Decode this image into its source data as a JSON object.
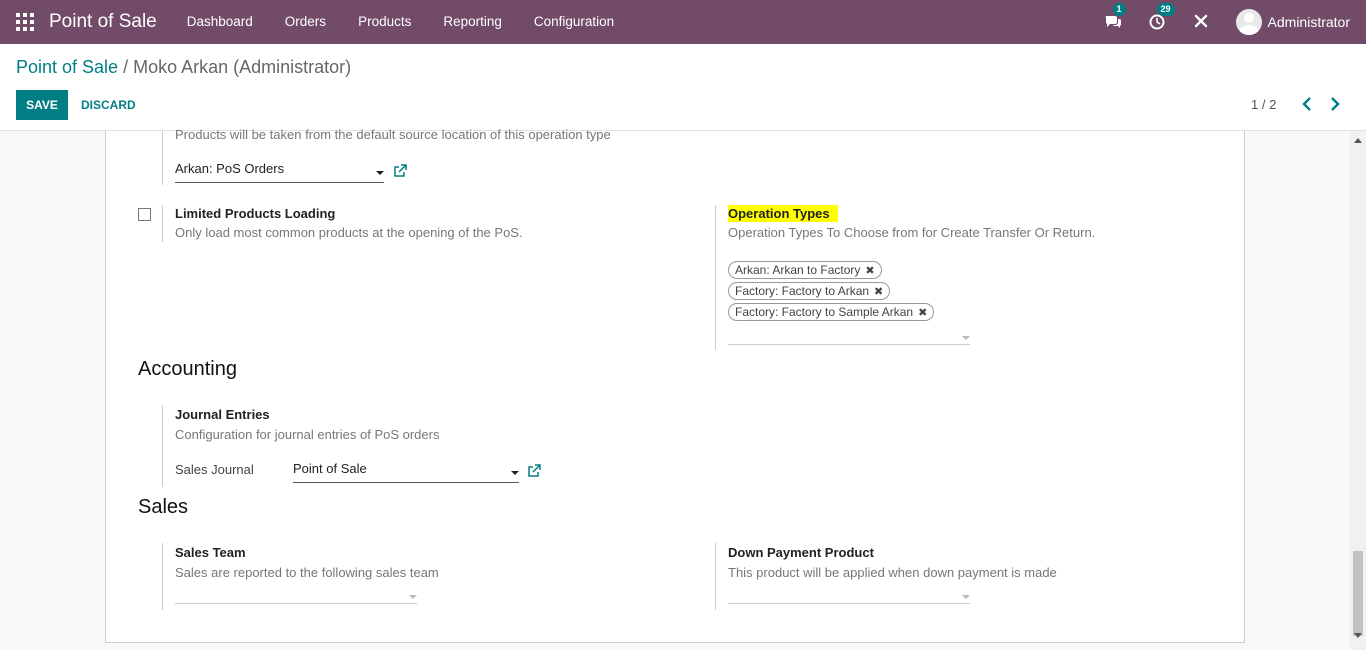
{
  "navbar": {
    "brand": "Point of Sale",
    "menu": [
      "Dashboard",
      "Orders",
      "Products",
      "Reporting",
      "Configuration"
    ],
    "messages_count": "1",
    "activities_count": "29",
    "user_name": "Administrator",
    "accent_color": "#714b67"
  },
  "breadcrumb": {
    "parent": "Point of Sale",
    "separator": "/",
    "current": "Moko Arkan (Administrator)"
  },
  "buttons": {
    "save": "SAVE",
    "discard": "DISCARD"
  },
  "pager": {
    "text": "1 / 2"
  },
  "form": {
    "top_desc": "Products will be taken from the default source location of this operation type",
    "top_select": "Arkan: PoS Orders",
    "limited_loading": {
      "label": "Limited Products Loading",
      "desc": "Only load most common products at the opening of the PoS.",
      "checked": false
    },
    "operation_types": {
      "label": "Operation Types",
      "desc": "Operation Types To Choose from for Create Transfer Or Return.",
      "tags": [
        "Arkan: Arkan to Factory",
        "Factory: Factory to Arkan",
        "Factory: Factory to Sample Arkan"
      ],
      "tag_remove": "✖"
    },
    "accounting": {
      "title": "Accounting",
      "journal_label": "Journal Entries",
      "journal_desc": "Configuration for journal entries of PoS orders",
      "sales_journal_label": "Sales Journal",
      "sales_journal_value": "Point of Sale"
    },
    "sales": {
      "title": "Sales",
      "team_label": "Sales Team",
      "team_desc": "Sales are reported to the following sales team",
      "down_payment_label": "Down Payment Product",
      "down_payment_desc": "This product will be applied when down payment is made"
    }
  }
}
